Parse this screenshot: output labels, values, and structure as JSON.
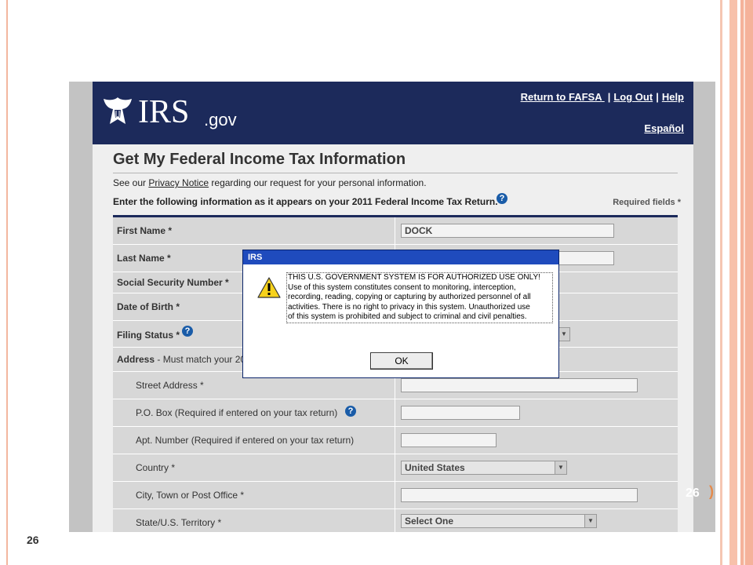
{
  "slide": {
    "page_number": "26",
    "badge": "26",
    "badge_paren": ")"
  },
  "header": {
    "logo_text": "IRS",
    "logo_suffix": ".gov",
    "links": [
      {
        "label": "Return to FAFSA "
      },
      {
        "label": "Log Out"
      },
      {
        "label": "Help"
      }
    ],
    "separator": "|",
    "language_link": "Español"
  },
  "page": {
    "title": "Get My Federal Income Tax Information",
    "privacy_prefix": "See our ",
    "privacy_link": "Privacy Notice",
    "privacy_suffix": " regarding our request for your personal information.",
    "instruction": "Enter the following information as it appears on your 2011 Federal Income Tax Return.",
    "required_note": "Required fields *",
    "help_glyph": "?"
  },
  "form": {
    "first_name": {
      "label": "First Name *",
      "value": "DOCK"
    },
    "last_name": {
      "label": "Last Name *"
    },
    "ssn": {
      "label": "Social Security Number *"
    },
    "dob": {
      "label": "Date of Birth  *"
    },
    "filing_status": {
      "label": "Filing Status *"
    },
    "address": {
      "label": "Address",
      "extra": " - Must match your 20"
    },
    "street": {
      "label": "Street Address *"
    },
    "po_box": {
      "label": "P.O. Box (Required if entered on your tax return)"
    },
    "apt": {
      "label": "Apt. Number (Required if entered on your tax return)"
    },
    "country": {
      "label": "Country *",
      "value": "United States"
    },
    "city": {
      "label": "City, Town or Post Office *"
    },
    "state": {
      "label": "State/U.S. Territory *",
      "value": "Select One"
    }
  },
  "dialog": {
    "title": "IRS",
    "message_lines": [
      "THIS U.S. GOVERNMENT SYSTEM IS FOR AUTHORIZED USE ONLY!",
      "Use of this system constitutes consent to monitoring, interception,",
      "recording, reading, copying or capturing by authorized personnel of all",
      "activities. There is no right to privacy in this system. Unauthorized use",
      "of this system is prohibited and subject to criminal and civil penalties."
    ],
    "ok_label": "OK"
  }
}
